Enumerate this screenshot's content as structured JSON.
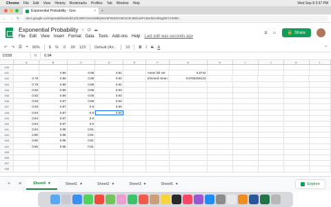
{
  "macbar": {
    "apple": "",
    "app": "Chrome",
    "menus": [
      "File",
      "Edit",
      "View",
      "History",
      "Bookmarks",
      "Profiles",
      "Tab",
      "Window",
      "Help"
    ],
    "datetime": "Wed Sep 8  3:37 PM"
  },
  "browser": {
    "tab_title": "Exponential Probability - Goo",
    "tab_close": "×",
    "new_tab": "+",
    "url": "docs.google.com/spreadsheets/d/1Jrb1WKC5H1nMbQe6V5F9NGDH5G2n0rJBdco6FCBorlDzebRgddcY1/0!90...",
    "nav": [
      "←",
      "→",
      "↻"
    ]
  },
  "header": {
    "title": "Exponential Probability",
    "star": "☆",
    "move": "⊡",
    "cloud": "☁",
    "menus": [
      "File",
      "Edit",
      "View",
      "Insert",
      "Format",
      "Data",
      "Tools",
      "Add-ons",
      "Help"
    ],
    "last_edit": "Last edit was seconds ago",
    "share": "Share",
    "lock": "🔒",
    "comment": "☰",
    "present": "▭"
  },
  "toolbar": {
    "undo": "↶",
    "redo": "↷",
    "print": "⎙",
    "paint": "⌖",
    "zoom": "90%",
    "currency": "$",
    "percent": "%",
    "dec_less": ".0",
    "dec_more": ".00",
    "format": "123",
    "font": "Default (Ari...",
    "font_size": "10",
    "bold": "B",
    "italic": "I",
    "strike": "S",
    "color": "A",
    "caret": "^"
  },
  "formula": {
    "cell": "D158",
    "fx": "fx",
    "value": "0.94"
  },
  "columns": [
    "",
    "A",
    "B",
    "C",
    "D",
    "E",
    "F",
    "G",
    "H",
    "I",
    "J",
    "K",
    "L"
  ],
  "rows": [
    {
      "n": "146",
      "c": [
        "",
        "",
        "",
        "",
        "",
        "",
        "",
        "",
        "",
        "",
        "",
        ""
      ]
    },
    {
      "n": "151",
      "c": [
        "",
        "0.86",
        "0.88",
        "0.91",
        "",
        "mean full set",
        "0.8742",
        "",
        "",
        "",
        "",
        ""
      ]
    },
    {
      "n": "152",
      "c": [
        "0.79",
        "0.86",
        "0.88",
        "0.92",
        "",
        "trimmed mean",
        "0.8765306122",
        "",
        "",
        "",
        "",
        ""
      ]
    },
    {
      "n": "153",
      "c": [
        "0.79",
        "0.86",
        "0.88",
        "0.92",
        "",
        "",
        "",
        "",
        "",
        "",
        "",
        ""
      ]
    },
    {
      "n": "154",
      "c": [
        "0.82",
        "0.86",
        "0.89",
        "0.93",
        "",
        "",
        "",
        "",
        "",
        "",
        "",
        ""
      ]
    },
    {
      "n": "155",
      "c": [
        "0.82",
        "0.86",
        "0.89",
        "0.93",
        "",
        "",
        "",
        "",
        "",
        "",
        "",
        ""
      ]
    },
    {
      "n": "156",
      "c": [
        "0.83",
        "0.87",
        "0.89",
        "0.93",
        "",
        "",
        "",
        "",
        "",
        "",
        "",
        ""
      ]
    },
    {
      "n": "157",
      "c": [
        "0.83",
        "0.87",
        "0.9",
        "0.94",
        "",
        "",
        "",
        "",
        "",
        "",
        "",
        ""
      ]
    },
    {
      "n": "158",
      "c": [
        "0.84",
        "0.87",
        "0.9",
        "0.94",
        "",
        "",
        "",
        "",
        "",
        "",
        "",
        ""
      ]
    },
    {
      "n": "159",
      "c": [
        "0.84",
        "0.87",
        "0.9",
        "",
        "",
        "",
        "",
        "",
        "",
        "",
        "",
        ""
      ]
    },
    {
      "n": "160",
      "c": [
        "0.84",
        "0.87",
        "0.9",
        "",
        "",
        "",
        "",
        "",
        "",
        "",
        "",
        ""
      ]
    },
    {
      "n": "161",
      "c": [
        "0.84",
        "0.88",
        "0.91",
        "",
        "",
        "",
        "",
        "",
        "",
        "",
        "",
        ""
      ]
    },
    {
      "n": "162",
      "c": [
        "0.85",
        "0.88",
        "0.91",
        "",
        "",
        "",
        "",
        "",
        "",
        "",
        "",
        ""
      ]
    },
    {
      "n": "163",
      "c": [
        "0.85",
        "0.88",
        "0.91",
        "",
        "",
        "",
        "",
        "",
        "",
        "",
        "",
        ""
      ]
    },
    {
      "n": "164",
      "c": [
        "0.86",
        "0.88",
        "0.91",
        "",
        "",
        "",
        "",
        "",
        "",
        "",
        "",
        ""
      ]
    },
    {
      "n": "165",
      "c": [
        "",
        "",
        "",
        "",
        "",
        "",
        "",
        "",
        "",
        "",
        "",
        ""
      ]
    },
    {
      "n": "166",
      "c": [
        "",
        "",
        "",
        "",
        "",
        "",
        "",
        "",
        "",
        "",
        "",
        ""
      ]
    },
    {
      "n": "167",
      "c": [
        "",
        "",
        "",
        "",
        "",
        "",
        "",
        "",
        "",
        "",
        "",
        ""
      ]
    },
    {
      "n": "168",
      "c": [
        "",
        "",
        "",
        "",
        "",
        "",
        "",
        "",
        "",
        "",
        "",
        ""
      ]
    }
  ],
  "sheets": {
    "add": "+",
    "list": "≡",
    "tabs": [
      "Sheet4",
      "Sheet1",
      "Sheet2",
      "Sheet3",
      "Sheet5"
    ],
    "active": "Sheet4",
    "explore": "Explore"
  },
  "colors": {
    "accent": "#0f9d58",
    "selection": "#1a73e8"
  }
}
